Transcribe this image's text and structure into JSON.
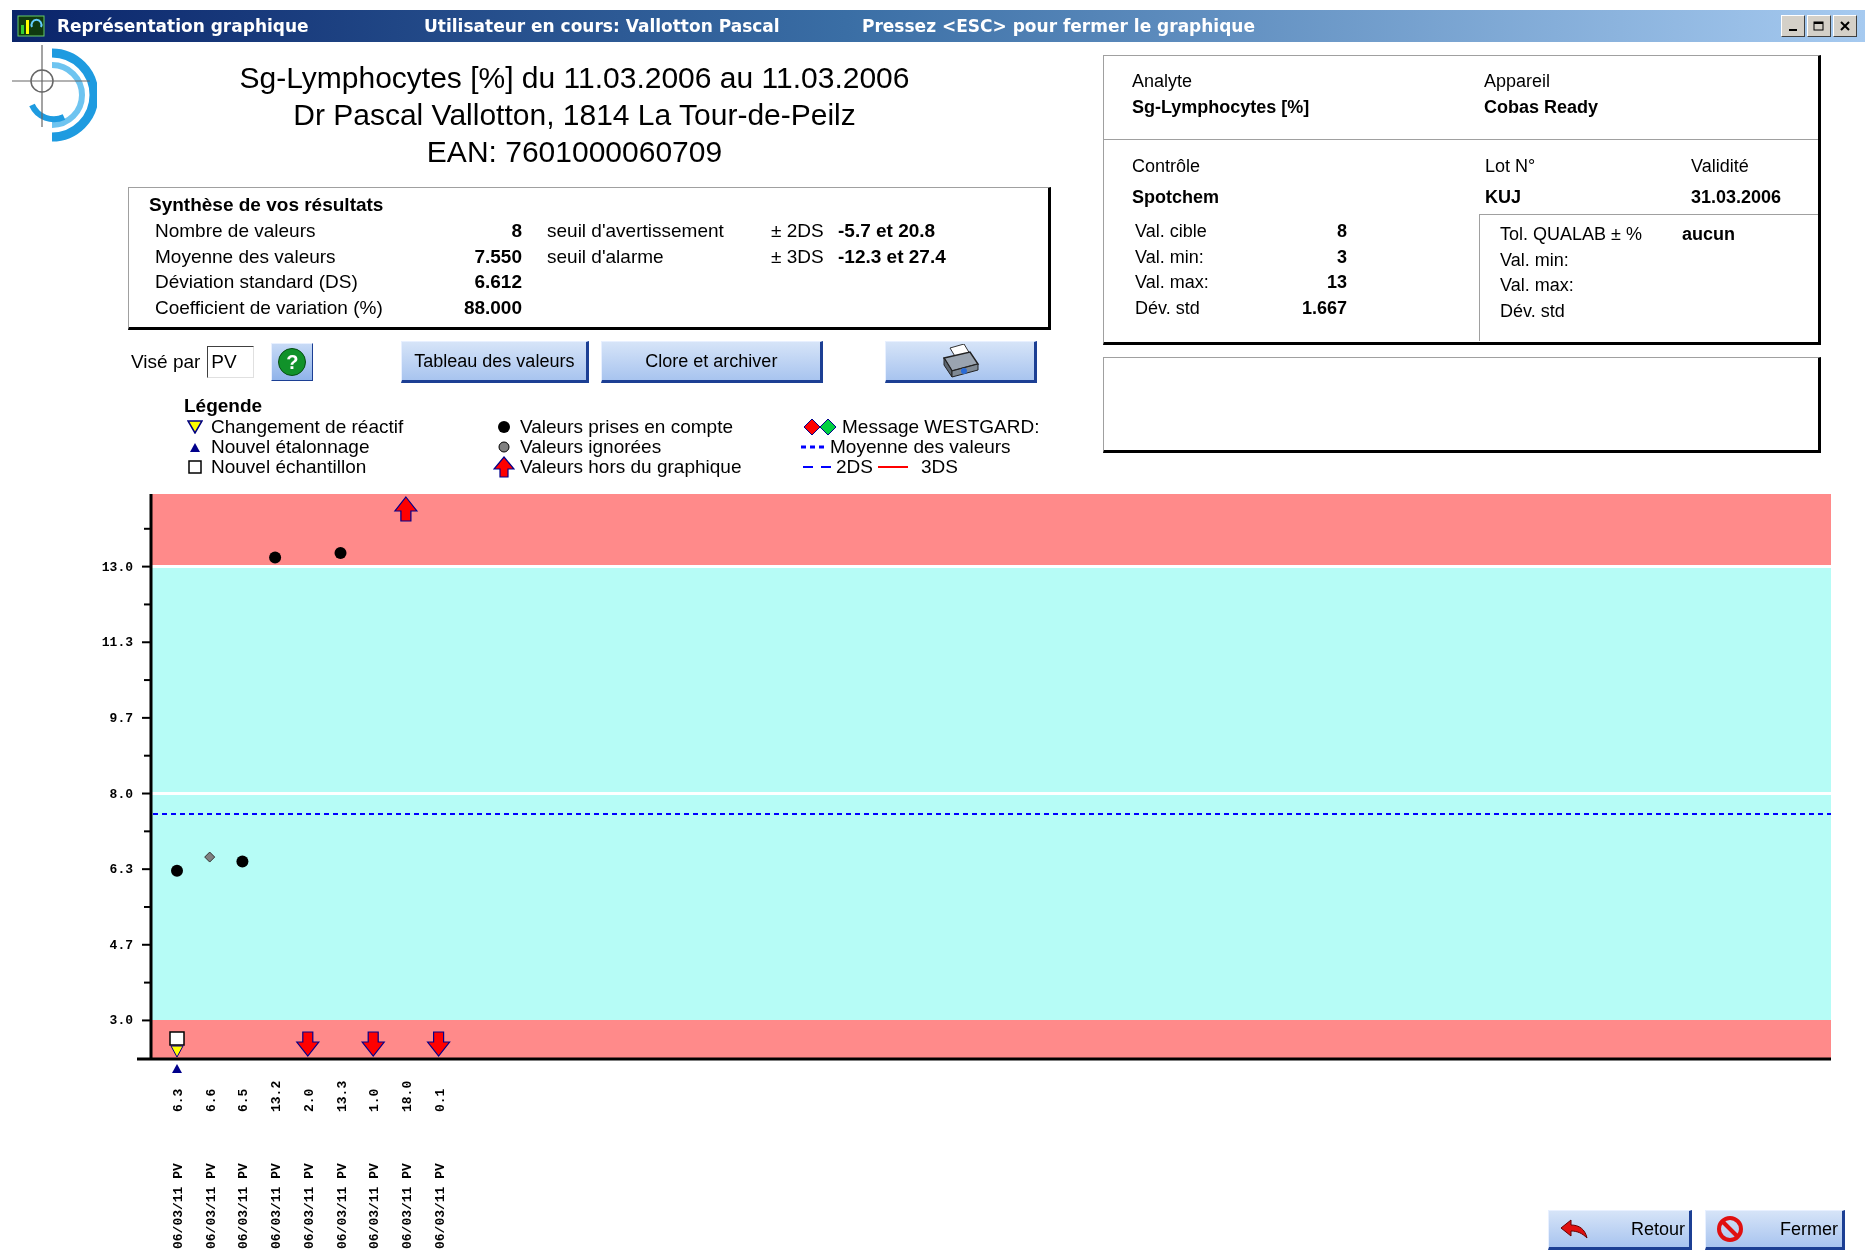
{
  "window": {
    "title": "Représentation graphique",
    "user": "Utilisateur en cours: Vallotton Pascal",
    "hint": "Pressez <ESC> pour fermer le graphique"
  },
  "header": {
    "lines": [
      "Sg-Lymphocytes [%] du 11.03.2006 au 11.03.2006",
      "Dr Pascal Vallotton, 1814 La Tour-de-Peilz",
      "EAN: 7601000060709"
    ]
  },
  "summary": {
    "title": "Synthèse de vos résultats",
    "stats": [
      {
        "label": "Nombre de valeurs",
        "value": "8"
      },
      {
        "label": "Moyenne des valeurs",
        "value": "7.550"
      },
      {
        "label": "Déviation standard (DS)",
        "value": "6.612"
      },
      {
        "label": "Coefficient de variation (%)",
        "value": "88.000"
      }
    ],
    "thresholds": [
      {
        "label": "seuil d'avertissement",
        "range": "± 2DS",
        "value": "-5.7 et 20.8"
      },
      {
        "label": "seuil d'alarme",
        "range": "± 3DS",
        "value": "-12.3 et 27.4"
      }
    ]
  },
  "toolbar": {
    "vise_label": "Visé par",
    "vise_value": "PV",
    "buttons": [
      {
        "kind": "help",
        "label": "?"
      },
      {
        "kind": "text",
        "label": "Tableau des valeurs"
      },
      {
        "kind": "text",
        "label": "Clore et archiver"
      },
      {
        "kind": "print"
      }
    ]
  },
  "legend": {
    "title": "Légende",
    "columns": [
      {
        "items": [
          {
            "kind": "reagent",
            "label": "Changement de réactif"
          },
          {
            "kind": "calibration",
            "label": "Nouvel étalonnage"
          },
          {
            "kind": "sample",
            "label": "Nouvel échantillon"
          }
        ]
      },
      {
        "items": [
          {
            "kind": "taken",
            "label": "Valeurs prises en compte"
          },
          {
            "kind": "ignored",
            "label": "Valeurs ignorées"
          },
          {
            "kind": "out_of_range",
            "label": "Valeurs hors du graphique"
          }
        ]
      },
      {
        "items": [
          {
            "kind": "westgard",
            "label": "Message WESTGARD:"
          },
          {
            "kind": "mean",
            "label": "Moyenne des valeurs"
          },
          {
            "kind": "sd_lines",
            "labels": [
              "2DS",
              "3DS"
            ]
          }
        ]
      }
    ]
  },
  "info": {
    "analyte_label": "Analyte",
    "analyte": "Sg-Lymphocytes [%]",
    "device_label": "Appareil",
    "device": "Cobas Ready",
    "control_label": "Contrôle",
    "control": "Spotchem",
    "lot_label": "Lot N°",
    "lot": "KUJ",
    "validity_label": "Validité",
    "validity": "31.03.2006",
    "stats": [
      {
        "label": "Val. cible",
        "value": "8"
      },
      {
        "label": "Val. min:",
        "value": "3"
      },
      {
        "label": "Val. max:",
        "value": "13"
      },
      {
        "label": "Dév. std",
        "value": "1.667"
      }
    ],
    "qualab": [
      {
        "label": "Tol. QUALAB ± %",
        "value": "aucun"
      },
      {
        "label": "Val. min:"
      },
      {
        "label": "Val. max:"
      },
      {
        "label": "Dév. std"
      }
    ]
  },
  "chart": {
    "chart_data": {
      "type": "scatter",
      "categories": [
        "06/03/11 PV",
        "06/03/11 PV",
        "06/03/11 PV",
        "06/03/11 PV",
        "06/03/11 PV",
        "06/03/11 PV",
        "06/03/11 PV",
        "06/03/11 PV",
        "06/03/11 PV"
      ],
      "value_labels": [
        "6.3",
        "6.6",
        "6.5",
        "13.2",
        "2.0",
        "13.3",
        "1.0",
        "18.0",
        "0.1"
      ],
      "series": [
        {
          "color": "#000000",
          "marker": "circle",
          "values": [
            6.3,
            null,
            6.5,
            13.2,
            null,
            13.3,
            null,
            null,
            null
          ]
        },
        {
          "color": "#808080",
          "marker": "diamond",
          "values": [
            null,
            6.6,
            null,
            null,
            null,
            null,
            null,
            null,
            null
          ]
        }
      ],
      "ylim": [
        2.15,
        14.6
      ],
      "yticks": [
        {
          "value": 3.0,
          "label": "3.0"
        },
        {
          "value": 4.667,
          "label": "4.7"
        },
        {
          "value": 6.333,
          "label": "6.3"
        },
        {
          "value": 8.0,
          "label": "8.0"
        },
        {
          "value": 9.667,
          "label": "9.7"
        },
        {
          "value": 11.333,
          "label": "11.3"
        },
        {
          "value": 13.0,
          "label": "13.0"
        }
      ]
    },
    "points": [
      {
        "above": false,
        "below": false,
        "new_sample": true,
        "reagent_change": true,
        "calibration": true
      },
      {
        "above": false,
        "below": false,
        "new_sample": false,
        "reagent_change": false,
        "calibration": false
      },
      {
        "above": false,
        "below": false,
        "new_sample": false,
        "reagent_change": false,
        "calibration": false
      },
      {
        "above": false,
        "below": false,
        "new_sample": false,
        "reagent_change": false,
        "calibration": false
      },
      {
        "above": false,
        "below": true,
        "new_sample": false,
        "reagent_change": false,
        "calibration": false
      },
      {
        "above": false,
        "below": false,
        "new_sample": false,
        "reagent_change": false,
        "calibration": false
      },
      {
        "above": false,
        "below": true,
        "new_sample": false,
        "reagent_change": false,
        "calibration": false
      },
      {
        "above": true,
        "below": false,
        "new_sample": false,
        "reagent_change": false,
        "calibration": false
      },
      {
        "above": false,
        "below": true,
        "new_sample": false,
        "reagent_change": false,
        "calibration": false
      }
    ]
  },
  "footer_buttons": [
    {
      "kind": "back",
      "label": "Retour"
    },
    {
      "kind": "close",
      "label": "Fermer"
    }
  ]
}
